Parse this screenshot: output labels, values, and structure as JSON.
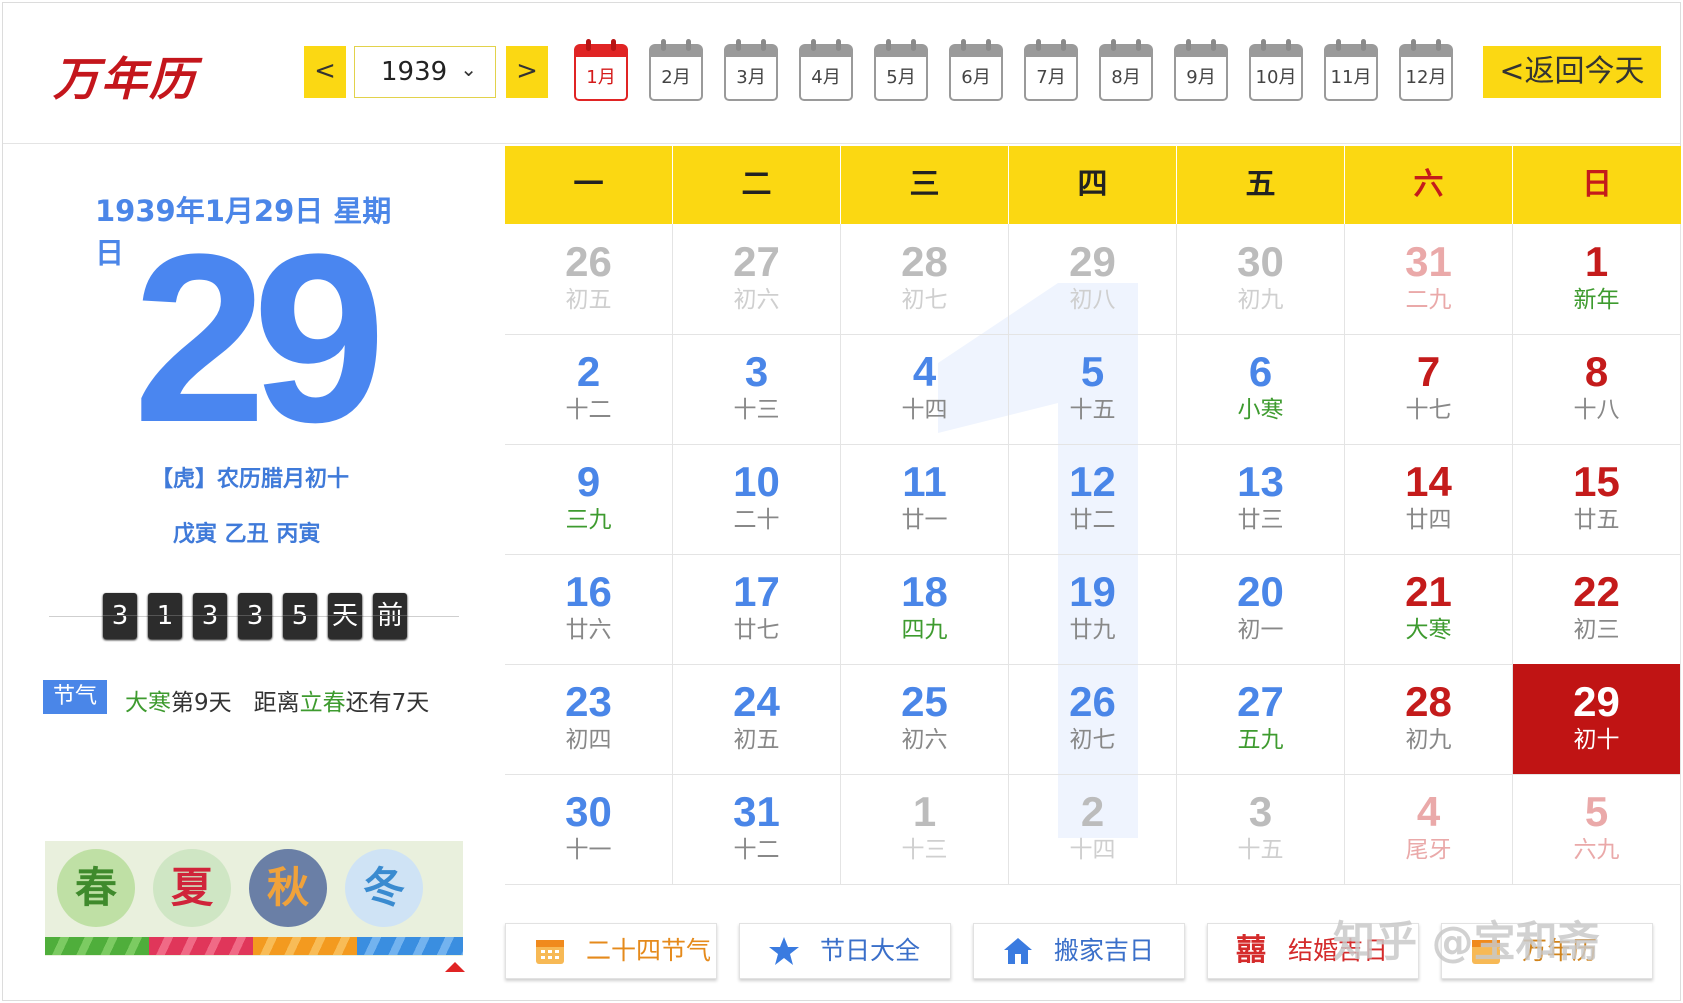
{
  "header": {
    "logo": "万年历",
    "prev": "<",
    "next": ">",
    "year": "1939",
    "months": [
      "1月",
      "2月",
      "3月",
      "4月",
      "5月",
      "6月",
      "7月",
      "8月",
      "9月",
      "10月",
      "11月",
      "12月"
    ],
    "active_month_index": 0,
    "today_button": "<返回今天"
  },
  "left": {
    "date_title": "1939年1月29日 星期日",
    "big_day": "29",
    "lunar_line": "【虎】农历腊月初十",
    "ganzhi": "戊寅 乙丑 丙寅",
    "counter": [
      "3",
      "1",
      "3",
      "3",
      "5",
      "天",
      "前"
    ],
    "jieqi_tag": "节气",
    "jieqi_prefix_green": "大寒",
    "jieqi_prefix_rest": "第9天",
    "jieqi_mid": "距离",
    "jieqi_next_green": "立春",
    "jieqi_suffix": "还有7天",
    "seasons": [
      "春",
      "夏",
      "秋",
      "冬"
    ]
  },
  "calendar": {
    "weekdays": [
      "一",
      "二",
      "三",
      "四",
      "五",
      "六",
      "日"
    ],
    "weeks": [
      [
        [
          "26",
          "初五",
          "other"
        ],
        [
          "27",
          "初六",
          "other"
        ],
        [
          "28",
          "初七",
          "other"
        ],
        [
          "29",
          "初八",
          "other"
        ],
        [
          "30",
          "初九",
          "other"
        ],
        [
          "31",
          "二九",
          "other"
        ],
        [
          "1",
          "新年",
          "green"
        ]
      ],
      [
        [
          "2",
          "十二",
          ""
        ],
        [
          "3",
          "十三",
          ""
        ],
        [
          "4",
          "十四",
          ""
        ],
        [
          "5",
          "十五",
          ""
        ],
        [
          "6",
          "小寒",
          "green"
        ],
        [
          "7",
          "十七",
          ""
        ],
        [
          "8",
          "十八",
          ""
        ]
      ],
      [
        [
          "9",
          "三九",
          "green"
        ],
        [
          "10",
          "二十",
          ""
        ],
        [
          "11",
          "廿一",
          ""
        ],
        [
          "12",
          "廿二",
          ""
        ],
        [
          "13",
          "廿三",
          ""
        ],
        [
          "14",
          "廿四",
          ""
        ],
        [
          "15",
          "廿五",
          ""
        ]
      ],
      [
        [
          "16",
          "廿六",
          ""
        ],
        [
          "17",
          "廿七",
          ""
        ],
        [
          "18",
          "四九",
          "green"
        ],
        [
          "19",
          "廿九",
          ""
        ],
        [
          "20",
          "初一",
          ""
        ],
        [
          "21",
          "大寒",
          "green"
        ],
        [
          "22",
          "初三",
          ""
        ]
      ],
      [
        [
          "23",
          "初四",
          ""
        ],
        [
          "24",
          "初五",
          ""
        ],
        [
          "25",
          "初六",
          ""
        ],
        [
          "26",
          "初七",
          ""
        ],
        [
          "27",
          "五九",
          "green"
        ],
        [
          "28",
          "初九",
          ""
        ],
        [
          "29",
          "初十",
          "today"
        ]
      ],
      [
        [
          "30",
          "十一",
          ""
        ],
        [
          "31",
          "十二",
          ""
        ],
        [
          "1",
          "十三",
          "other"
        ],
        [
          "2",
          "十四",
          "other"
        ],
        [
          "3",
          "十五",
          "other"
        ],
        [
          "4",
          "尾牙",
          "other"
        ],
        [
          "5",
          "六九",
          "other"
        ]
      ]
    ]
  },
  "footer": {
    "buttons": [
      "二十四节气",
      "节日大全",
      "搬家吉日",
      "结婚吉日",
      "万年历"
    ],
    "watermark": "知乎 @宝和斋"
  },
  "colors": {
    "accent_yellow": "#fbd813",
    "blue": "#4a86e8",
    "red": "#c41b1b",
    "green": "#3e9b2f"
  }
}
